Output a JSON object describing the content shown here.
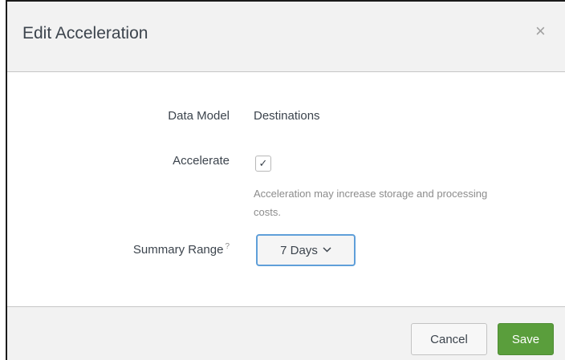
{
  "dialog": {
    "title": "Edit Acceleration",
    "close_icon": "×"
  },
  "form": {
    "data_model": {
      "label": "Data Model",
      "value": "Destinations"
    },
    "accelerate": {
      "label": "Accelerate",
      "checked": true,
      "check_glyph": "✓",
      "help": "Acceleration may increase storage and processing costs."
    },
    "summary_range": {
      "label": "Summary Range",
      "help_marker": "?",
      "selected": "7 Days",
      "chevron": "⌄"
    }
  },
  "footer": {
    "cancel_label": "Cancel",
    "save_label": "Save"
  },
  "colors": {
    "save_button": "#5a9e3c",
    "dropdown_focus": "#5f9fd9",
    "header_bg": "#f2f2f2"
  }
}
